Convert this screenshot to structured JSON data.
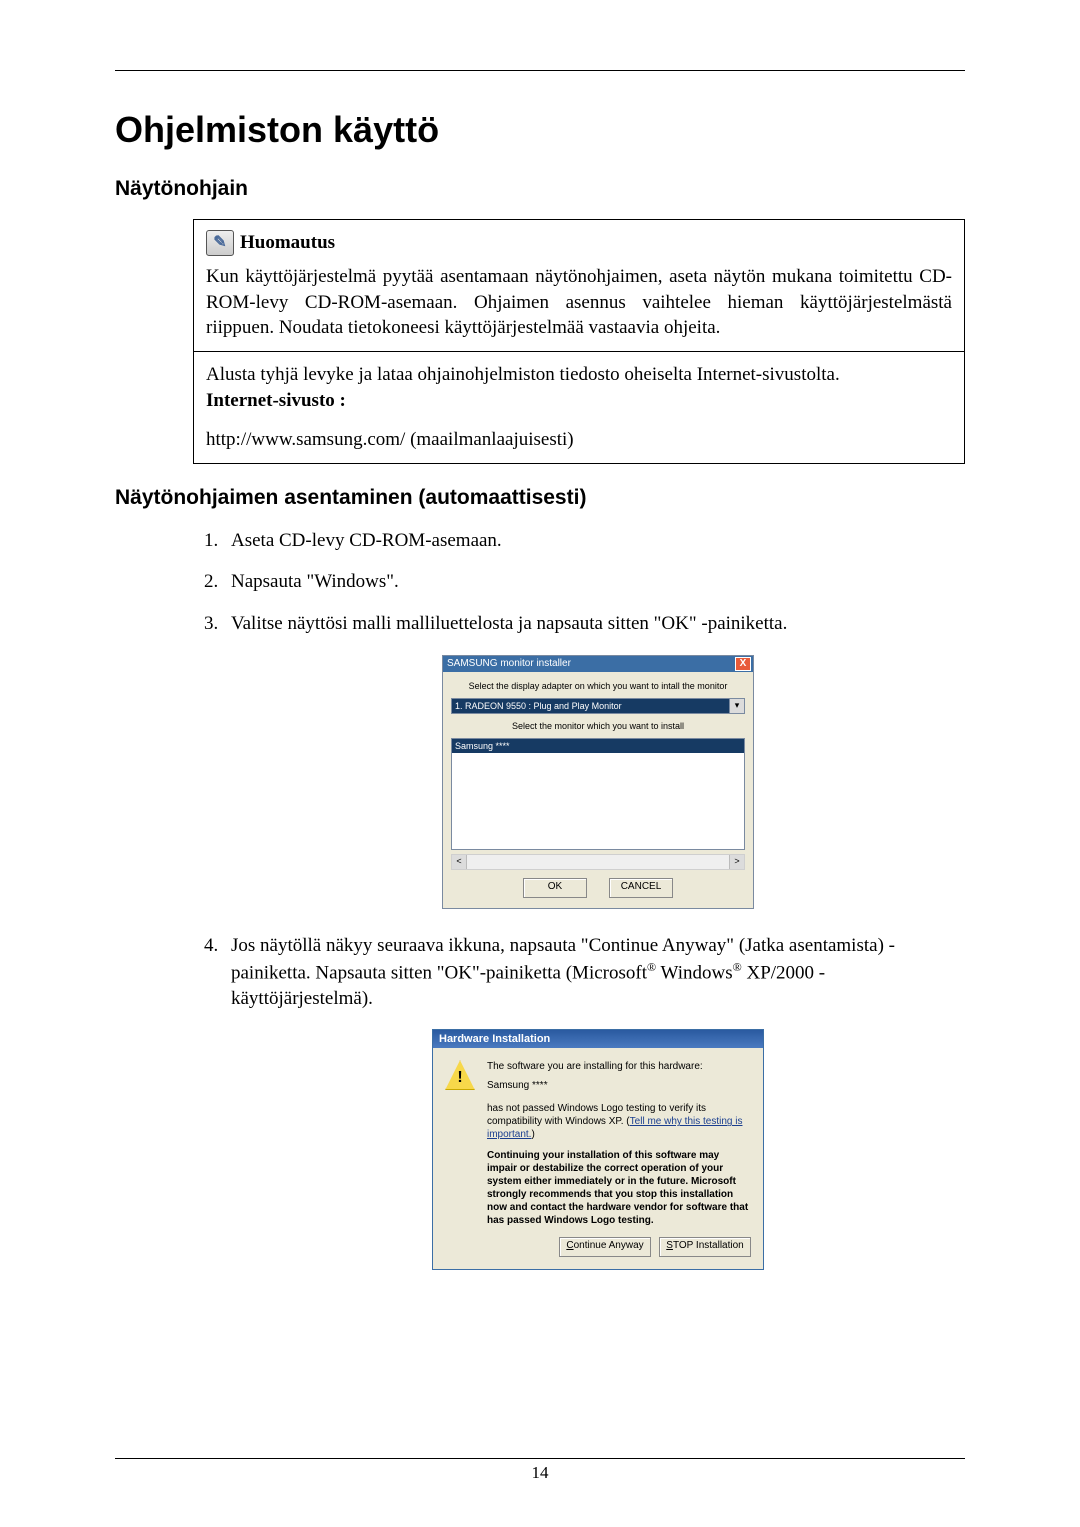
{
  "page": {
    "number": "14"
  },
  "heading": "Ohjelmiston käyttö",
  "section1": "Näytönohjain",
  "notice": {
    "label": "Huomautus",
    "body": "Kun käyttöjärjestelmä pyytää asentamaan näytönohjaimen, aseta näytön mukana toimitettu CD-ROM-levy CD-ROM-asemaan. Ohjaimen asennus vaihtelee hieman käyttöjärjestelmästä riippuen. Noudata tietokoneesi käyttöjärjestelmää vastaavia ohjeita.",
    "row2_line1": "Alusta tyhjä levyke ja lataa ohjainohjelmiston tiedosto oheiselta Internet-sivustolta.",
    "row2_bold": "Internet-sivusto :",
    "row2_url": "http://www.samsung.com/ (maailmanlaajuisesti)"
  },
  "section2": "Näytönohjaimen asentaminen (automaattisesti)",
  "steps": {
    "s1": "Aseta CD-levy CD-ROM-asemaan.",
    "s2": "Napsauta \"Windows\".",
    "s3": "Valitse näyttösi malli malliluettelosta ja napsauta sitten \"OK\" -painiketta.",
    "s4a": "Jos näytöllä näkyy seuraava ikkuna, napsauta \"Continue Anyway\" (Jatka asentamista) -painiketta. Napsauta sitten \"OK\"-painiketta (Microsoft",
    "s4b": " Windows",
    "s4c": " XP/2000 -käyttöjärjestelmä).",
    "reg": "®"
  },
  "installer": {
    "title": "SAMSUNG monitor installer",
    "label1": "Select the display adapter on which you want to intall the monitor",
    "combo": "1. RADEON 9550 : Plug and Play Monitor",
    "label2": "Select the monitor which you want to install",
    "selected": "Samsung ****",
    "ok": "OK",
    "cancel": "CANCEL",
    "close": "X",
    "left": "<",
    "right": ">",
    "down": "▾"
  },
  "hw": {
    "title": "Hardware Installation",
    "line1": "The software you are installing for this hardware:",
    "line2": "Samsung ****",
    "line3a": "has not passed Windows Logo testing to verify its compatibility with Windows XP. (",
    "link": "Tell me why this testing is important.",
    "line3b": ")",
    "bold": "Continuing your installation of this software may impair or destabilize the correct operation of your system either immediately or in the future. Microsoft strongly recommends that you stop this installation now and contact the hardware vendor for software that has passed Windows Logo testing.",
    "btn_continue_pre": "C",
    "btn_continue_rest": "ontinue Anyway",
    "btn_stop_pre": "S",
    "btn_stop_rest": "TOP Installation"
  }
}
